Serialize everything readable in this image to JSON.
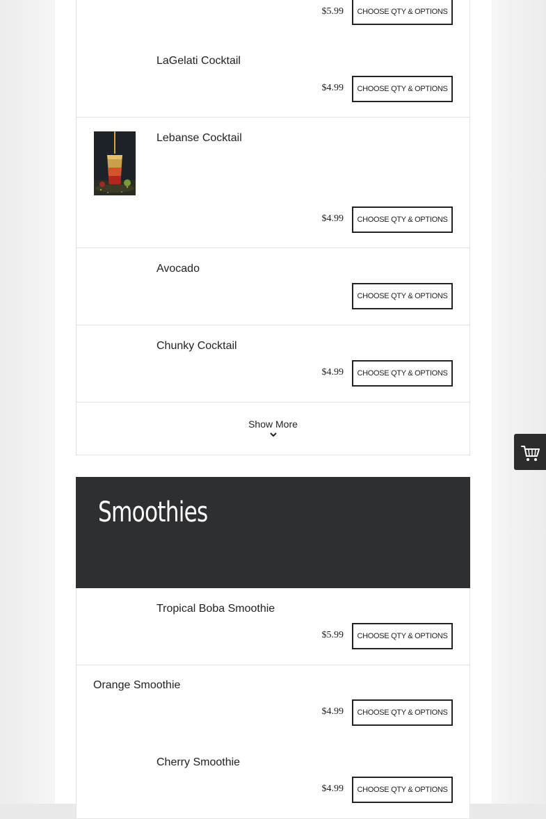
{
  "colors": {
    "section_header_bg": "#2e2f30",
    "cart_tab_bg": "#2c2c2c",
    "button_border": "#222222"
  },
  "items_top": [
    {
      "name": "",
      "price": "$5.99",
      "button": "CHOOSE QTY & OPTIONS"
    },
    {
      "name": "LaGelati Cocktail",
      "price": "$4.99",
      "button": "CHOOSE QTY & OPTIONS"
    },
    {
      "name": "Lebanse Cocktail",
      "price": "$4.99",
      "button": "CHOOSE QTY & OPTIONS",
      "image": "layered-cocktail-photo"
    },
    {
      "name": "Avocado",
      "price": "",
      "button": "CHOOSE QTY & OPTIONS"
    },
    {
      "name": "Chunky Cocktail",
      "price": "$4.99",
      "button": "CHOOSE QTY & OPTIONS"
    }
  ],
  "show_more": {
    "label": "Show More",
    "icon": "chevron-down-icon"
  },
  "smoothies": {
    "title": "Smoothies",
    "items": [
      {
        "name": "Tropical Boba Smoothie",
        "price": "$5.99",
        "button": "CHOOSE QTY & OPTIONS"
      },
      {
        "name": "Orange Smoothie",
        "price": "$4.99",
        "button": "CHOOSE QTY & OPTIONS"
      },
      {
        "name": "Cherry Smoothie",
        "price": "$4.99",
        "button": "CHOOSE QTY & OPTIONS"
      }
    ]
  },
  "cart": {
    "icon": "shopping-cart-icon"
  }
}
